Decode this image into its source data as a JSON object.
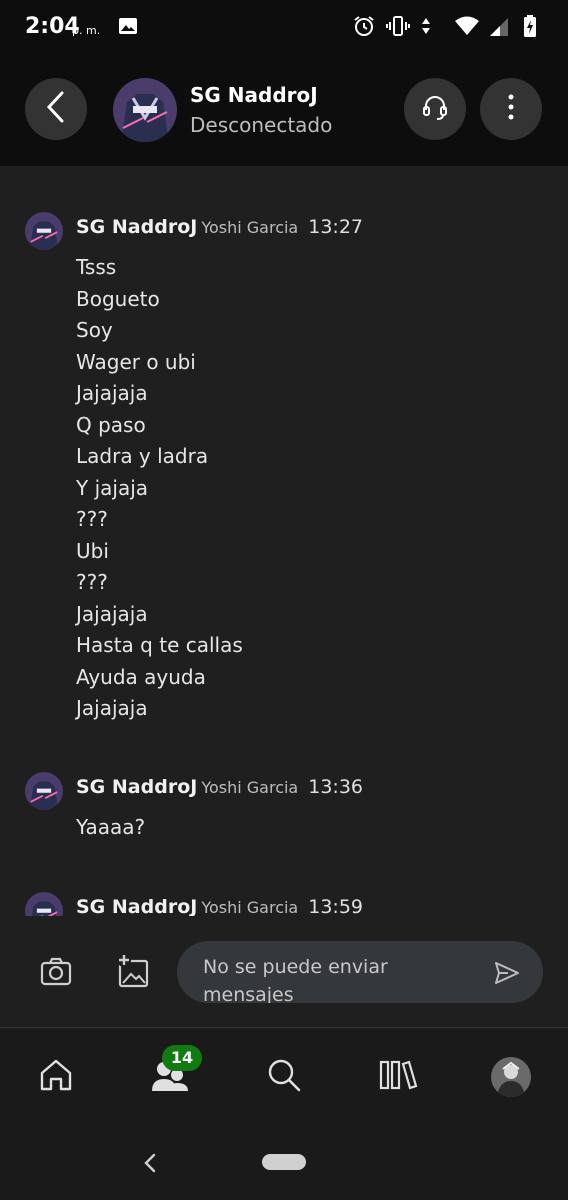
{
  "status_bar": {
    "time": "2:04",
    "ampm": "p. m.",
    "icons": [
      "image-icon",
      "alarm-icon",
      "vibrate-icon",
      "data-arrows-icon",
      "wifi-icon",
      "signal-icon",
      "battery-charging-icon"
    ]
  },
  "header": {
    "name": "SG NaddroJ",
    "status": "Desconectado",
    "icons": [
      "back-arrow-icon",
      "headset-icon",
      "more-vertical-icon"
    ]
  },
  "messages": [
    {
      "sender": "SG NaddroJ",
      "real_name": "Yoshi Garcia",
      "time": "13:27",
      "lines": [
        "Tsss",
        "Bogueto",
        "Soy",
        "Wager o ubi",
        "Jajajaja",
        "Q paso",
        "Ladra y ladra",
        "Y jajaja",
        "???",
        "Ubi",
        "???",
        "Jajajaja",
        "Hasta q te callas",
        "Ayuda ayuda",
        "Jajajaja"
      ]
    },
    {
      "sender": "SG NaddroJ",
      "real_name": "Yoshi Garcia",
      "time": "13:36",
      "lines": [
        "Yaaaa?"
      ]
    },
    {
      "sender": "SG NaddroJ",
      "real_name": "Yoshi Garcia",
      "time": "13:59",
      "lines": []
    }
  ],
  "composer": {
    "placeholder": "No se puede enviar mensajes",
    "icons": [
      "camera-icon",
      "add-image-icon",
      "send-icon"
    ]
  },
  "bottom_nav": {
    "badge_count": "14",
    "items": [
      "home-icon",
      "people-icon",
      "search-icon",
      "library-icon",
      "profile-avatar"
    ]
  },
  "colors": {
    "background": "#1f1f1f",
    "header": "#0d0d0d",
    "badge": "#107c10",
    "input": "#34373b"
  }
}
